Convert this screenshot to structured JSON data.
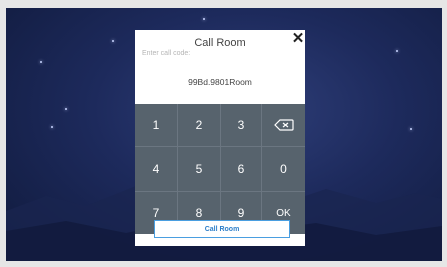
{
  "dialog": {
    "title": "Call Room",
    "close_icon": "close-icon",
    "input": {
      "placeholder": "Enter call code:",
      "value": "99Bd.9801Room"
    },
    "keypad": {
      "keys": [
        "1",
        "2",
        "3",
        "backspace",
        "4",
        "5",
        "6",
        "0",
        "7",
        "8",
        "9",
        "OK"
      ],
      "backspace_icon": "backspace-icon"
    },
    "call_button_label": "Call Room"
  },
  "colors": {
    "keypad_bg": "#57636d",
    "accent": "#4a9ee0",
    "background": "#1d2a5c"
  }
}
